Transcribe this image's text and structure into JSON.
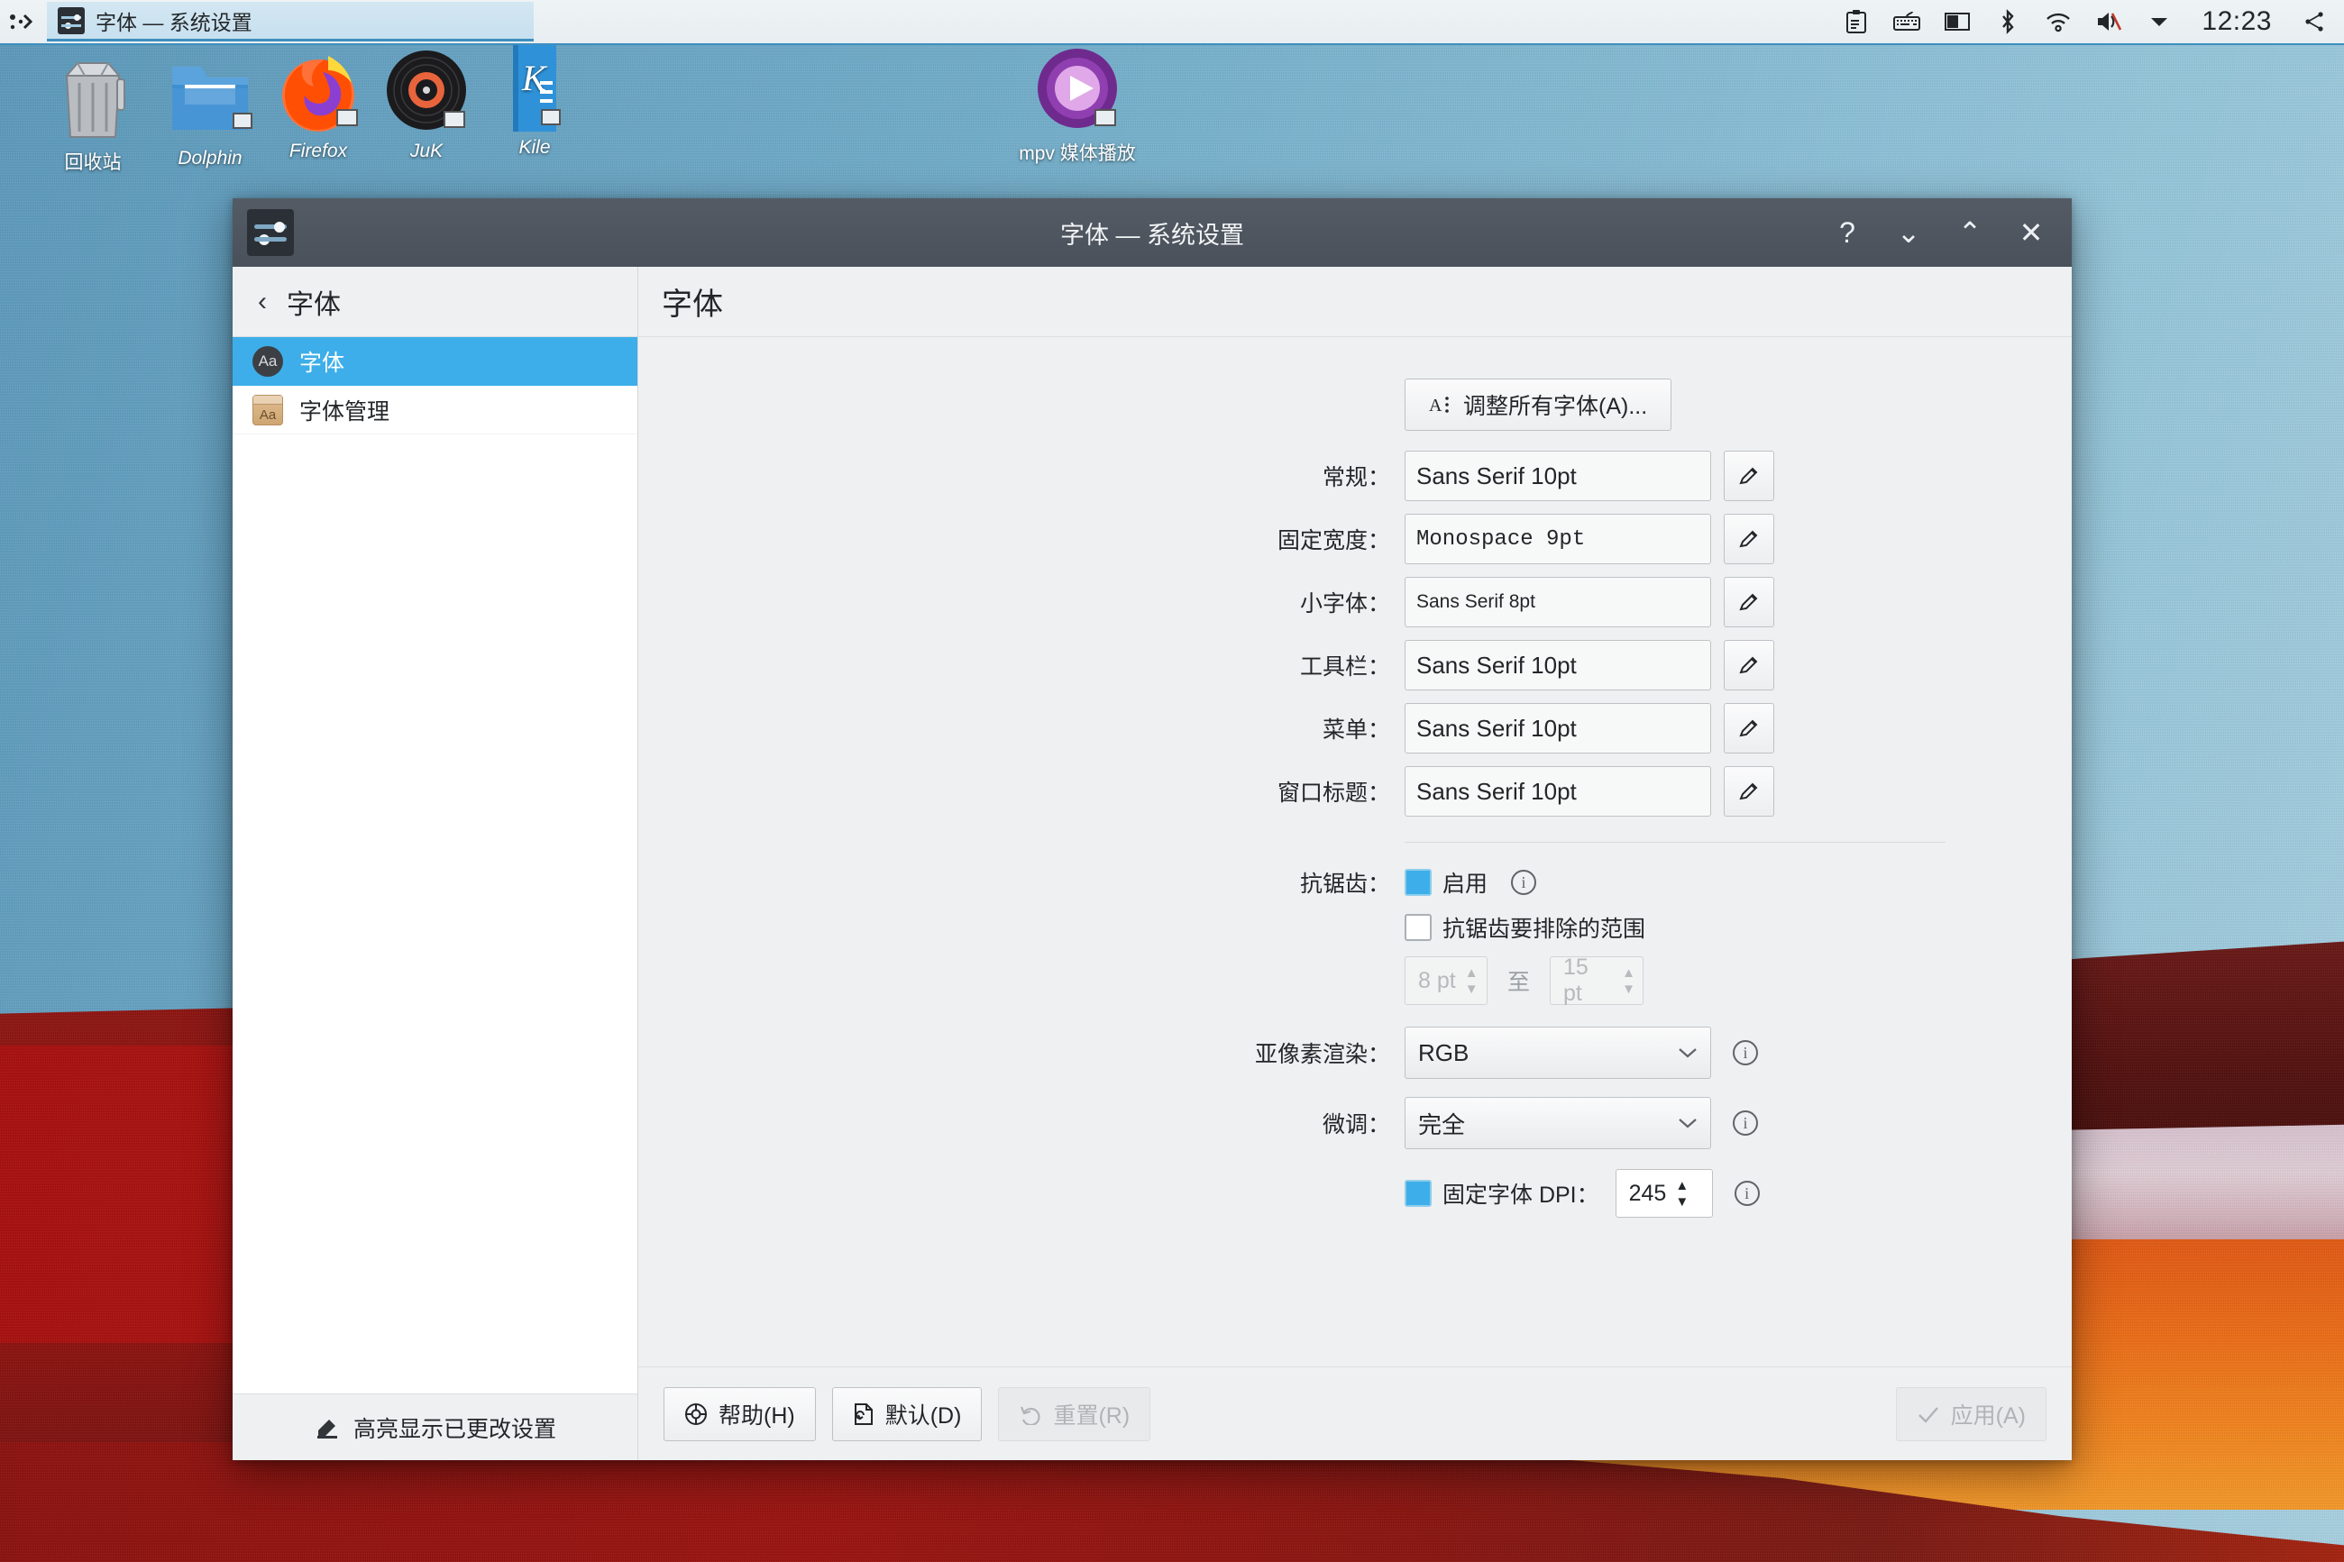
{
  "panel": {
    "launcher_icon": "kde-dots-icon",
    "task": {
      "icon": "system-settings-icon",
      "label": "字体 — 系统设置"
    },
    "tray": [
      {
        "icon": "clipboard-icon"
      },
      {
        "icon": "keyboard-layout-icon"
      },
      {
        "icon": "display-brightness-icon"
      },
      {
        "icon": "bluetooth-icon"
      },
      {
        "icon": "wifi-icon"
      },
      {
        "icon": "volume-muted-icon"
      },
      {
        "icon": "chevron-down-icon"
      }
    ],
    "clock": "12:23",
    "show_desktop_icon": "kde-dots-icon"
  },
  "desktop_icons": [
    {
      "name": "回收站",
      "icon": "trash-icon"
    },
    {
      "name": "Dolphin",
      "icon": "folder-icon"
    },
    {
      "name": "Firefox",
      "icon": "firefox-icon"
    },
    {
      "name": "JuK",
      "icon": "vinyl-record-icon"
    },
    {
      "name": "Kile",
      "icon": "kile-icon"
    },
    {
      "name": "mpv 媒体播放",
      "icon": "mpv-icon"
    }
  ],
  "window": {
    "title": "字体 — 系统设置",
    "buttons": {
      "help": "?",
      "minimize": "⌄",
      "maximize": "⌃",
      "close": "✕"
    }
  },
  "sidebar": {
    "back_icon": "chevron-left-icon",
    "header": "字体",
    "items": [
      {
        "label": "字体",
        "icon": "font-aa-icon",
        "selected": true
      },
      {
        "label": "字体管理",
        "icon": "font-package-icon",
        "selected": false
      }
    ],
    "footer": {
      "label": "高亮显示已更改设置",
      "icon": "highlighter-icon"
    }
  },
  "page": {
    "title": "字体",
    "adjust_all_button": {
      "label": "调整所有字体(A)...",
      "icon": "font-size-icon"
    },
    "font_rows": [
      {
        "label": "常规：",
        "value": "Sans Serif 10pt",
        "edit_icon": "pencil-icon",
        "style": "normal"
      },
      {
        "label": "固定宽度：",
        "value": "Monospace  9pt",
        "edit_icon": "pencil-icon",
        "style": "mono"
      },
      {
        "label": "小字体：",
        "value": "Sans Serif 8pt",
        "edit_icon": "pencil-icon",
        "style": "small"
      },
      {
        "label": "工具栏：",
        "value": "Sans Serif 10pt",
        "edit_icon": "pencil-icon",
        "style": "normal"
      },
      {
        "label": "菜单：",
        "value": "Sans Serif 10pt",
        "edit_icon": "pencil-icon",
        "style": "normal"
      },
      {
        "label": "窗口标题：",
        "value": "Sans Serif 10pt",
        "edit_icon": "pencil-icon",
        "style": "normal"
      }
    ],
    "antialias": {
      "label": "抗锯齿：",
      "enable_label": "启用",
      "enable_checked": true,
      "info_icon": "info-icon",
      "exclude_label": "抗锯齿要排除的范围",
      "exclude_checked": false,
      "range_from": "8 pt",
      "range_to_label": "至",
      "range_to": "15 pt",
      "range_enabled": false
    },
    "subpixel": {
      "label": "亚像素渲染：",
      "value": "RGB",
      "info_icon": "info-icon",
      "dropdown_icon": "chevron-down-icon"
    },
    "hinting": {
      "label": "微调：",
      "value": "完全",
      "info_icon": "info-icon",
      "dropdown_icon": "chevron-down-icon"
    },
    "force_dpi": {
      "label": "固定字体 DPI：",
      "checked": true,
      "value": "245",
      "info_icon": "info-icon"
    }
  },
  "buttons": {
    "help": {
      "label": "帮助(H)",
      "icon": "lifebuoy-icon",
      "enabled": true
    },
    "defaults": {
      "label": "默认(D)",
      "icon": "document-revert-icon",
      "enabled": true
    },
    "reset": {
      "label": "重置(R)",
      "icon": "undo-icon",
      "enabled": false
    },
    "apply": {
      "label": "应用(A)",
      "icon": "check-icon",
      "enabled": false
    }
  },
  "colors": {
    "accent": "#3daee9",
    "titlebar": "#4e555f",
    "window_bg": "#eff0f1",
    "panel_bg": "#eef3f5"
  }
}
